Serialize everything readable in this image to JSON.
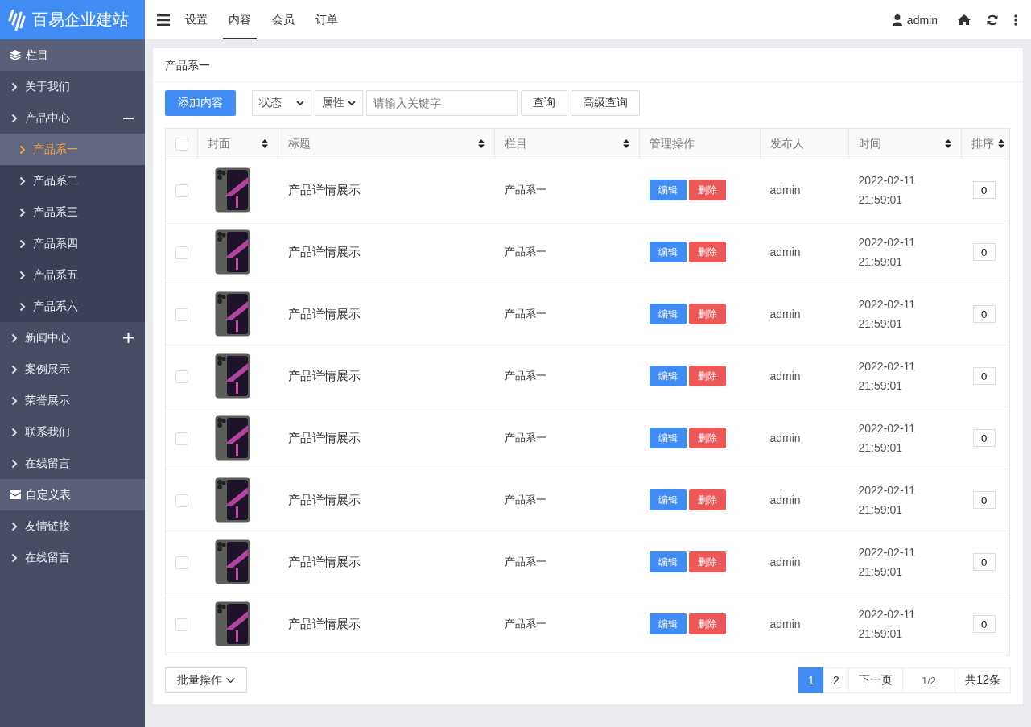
{
  "brand": {
    "title": "百易企业建站"
  },
  "top_nav": [
    {
      "label": "设置",
      "selected": false
    },
    {
      "label": "内容",
      "selected": true
    },
    {
      "label": "会员",
      "selected": false
    },
    {
      "label": "订单",
      "selected": false
    }
  ],
  "user": {
    "name": "admin"
  },
  "sidebar": [
    {
      "title": "栏目",
      "items": [
        {
          "label": "关于我们",
          "selected": false
        },
        {
          "label": "产品中心",
          "selected": false,
          "expanded": true,
          "children": [
            {
              "label": "产品系一",
              "selected": true
            },
            {
              "label": "产品系二",
              "selected": false
            },
            {
              "label": "产品系三",
              "selected": false
            },
            {
              "label": "产品系四",
              "selected": false
            },
            {
              "label": "产品系五",
              "selected": false
            },
            {
              "label": "产品系六",
              "selected": false
            }
          ]
        },
        {
          "label": "新闻中心",
          "selected": false,
          "expanded": false
        },
        {
          "label": "案例展示",
          "selected": false
        },
        {
          "label": "荣誉展示",
          "selected": false
        },
        {
          "label": "联系我们",
          "selected": false
        },
        {
          "label": "在线留言",
          "selected": false
        }
      ]
    },
    {
      "title": "自定义表",
      "items": [
        {
          "label": "友情链接",
          "selected": false
        },
        {
          "label": "在线留言",
          "selected": false
        }
      ]
    }
  ],
  "card": {
    "title": "产品系一"
  },
  "toolbar": {
    "add_button": "添加内容",
    "status_select": "状态",
    "attr_select": "属性",
    "search": {
      "placeholder": "请输入关键字"
    },
    "query_button": "查询",
    "advanced_button": "高级查询"
  },
  "table": {
    "all_checked": false,
    "columns": [
      {
        "label": "封面",
        "sortable": true
      },
      {
        "label": "标题",
        "sortable": true
      },
      {
        "label": "栏目",
        "sortable": true
      },
      {
        "label": "管理操作",
        "sortable": false
      },
      {
        "label": "发布人",
        "sortable": false
      },
      {
        "label": "时间",
        "sortable": true
      },
      {
        "label": "排序",
        "sortable": true
      }
    ],
    "rows": [
      {
        "checked": false,
        "title": "产品详情展示",
        "column": "产品系一",
        "edit": "编辑",
        "delete": "删除",
        "publisher": "admin",
        "time": "2022-02-11 21:59:01",
        "sort": "0"
      },
      {
        "checked": false,
        "title": "产品详情展示",
        "column": "产品系一",
        "edit": "编辑",
        "delete": "删除",
        "publisher": "admin",
        "time": "2022-02-11 21:59:01",
        "sort": "0"
      },
      {
        "checked": false,
        "title": "产品详情展示",
        "column": "产品系一",
        "edit": "编辑",
        "delete": "删除",
        "publisher": "admin",
        "time": "2022-02-11 21:59:01",
        "sort": "0"
      },
      {
        "checked": false,
        "title": "产品详情展示",
        "column": "产品系一",
        "edit": "编辑",
        "delete": "删除",
        "publisher": "admin",
        "time": "2022-02-11 21:59:01",
        "sort": "0"
      },
      {
        "checked": false,
        "title": "产品详情展示",
        "column": "产品系一",
        "edit": "编辑",
        "delete": "删除",
        "publisher": "admin",
        "time": "2022-02-11 21:59:01",
        "sort": "0"
      },
      {
        "checked": false,
        "title": "产品详情展示",
        "column": "产品系一",
        "edit": "编辑",
        "delete": "删除",
        "publisher": "admin",
        "time": "2022-02-11 21:59:01",
        "sort": "0"
      },
      {
        "checked": false,
        "title": "产品详情展示",
        "column": "产品系一",
        "edit": "编辑",
        "delete": "删除",
        "publisher": "admin",
        "time": "2022-02-11 21:59:01",
        "sort": "0"
      },
      {
        "checked": false,
        "title": "产品详情展示",
        "column": "产品系一",
        "edit": "编辑",
        "delete": "删除",
        "publisher": "admin",
        "time": "2022-02-11 21:59:01",
        "sort": "0"
      }
    ]
  },
  "footer": {
    "batch_button": "批量操作",
    "pages": [
      {
        "label": "1",
        "selected": true
      },
      {
        "label": "2",
        "selected": false
      }
    ],
    "next": "下一页",
    "page_info": "1/2",
    "total": "共12条"
  }
}
